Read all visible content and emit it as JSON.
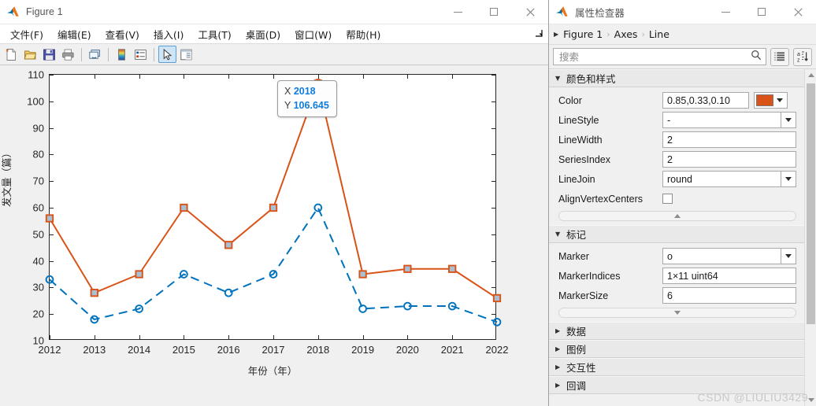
{
  "figure_window": {
    "title": "Figure 1",
    "app_icon": "matlab-logo-icon",
    "window_buttons": {
      "minimize": "—",
      "maximize": "□",
      "close": "✕"
    },
    "menu": [
      {
        "label": "文件(F)",
        "name": "menu-file"
      },
      {
        "label": "编辑(E)",
        "name": "menu-edit"
      },
      {
        "label": "查看(V)",
        "name": "menu-view"
      },
      {
        "label": "插入(I)",
        "name": "menu-insert"
      },
      {
        "label": "工具(T)",
        "name": "menu-tools"
      },
      {
        "label": "桌面(D)",
        "name": "menu-desktop"
      },
      {
        "label": "窗口(W)",
        "name": "menu-window"
      },
      {
        "label": "帮助(H)",
        "name": "menu-help"
      }
    ],
    "toolbar": [
      {
        "name": "new-figure-icon",
        "tooltip": "新建图窗"
      },
      {
        "name": "open-file-icon",
        "tooltip": "打开文件"
      },
      {
        "name": "save-figure-icon",
        "tooltip": "保存图窗"
      },
      {
        "name": "print-figure-icon",
        "tooltip": "打印图窗"
      },
      {
        "name": "link-plot-icon",
        "tooltip": "链接绘图"
      },
      {
        "name": "insert-colorbar-icon",
        "tooltip": "插入颜色栏"
      },
      {
        "name": "insert-legend-icon",
        "tooltip": "插入图例"
      },
      {
        "name": "data-cursor-icon",
        "tooltip": "数据游标",
        "active": true
      },
      {
        "name": "property-inspector-icon",
        "tooltip": "打开属性检查器"
      }
    ]
  },
  "chart_data": {
    "type": "line",
    "title": "",
    "xlabel": "年份（年）",
    "ylabel": "发文量（篇）",
    "xlim": [
      2012,
      2022
    ],
    "ylim": [
      10,
      110
    ],
    "yticks": [
      10,
      20,
      30,
      40,
      50,
      60,
      70,
      80,
      90,
      100,
      110
    ],
    "grid": false,
    "legend_position": "none",
    "categories": [
      2012,
      2013,
      2014,
      2015,
      2016,
      2017,
      2018,
      2019,
      2020,
      2021,
      2022
    ],
    "x_tick_labels": [
      "2012",
      "2013",
      "2014",
      "2015",
      "2016",
      "2017",
      "2018",
      "2019",
      "2020",
      "2021",
      "2022"
    ],
    "series": [
      {
        "name": "series-1-orange",
        "color": "#D95319",
        "linestyle": "-",
        "linewidth": 2,
        "marker": "s",
        "markerfacecolor": "#A9BFD2",
        "values": [
          56,
          28,
          35,
          60,
          46,
          60,
          106.645,
          35,
          37,
          37,
          26
        ]
      },
      {
        "name": "series-2-blue",
        "color": "#0072BD",
        "linestyle": "--",
        "linewidth": 2,
        "marker": "o",
        "markerfacecolor": "none",
        "values": [
          33,
          18,
          22,
          35,
          28,
          35,
          60,
          22,
          23,
          23,
          17
        ]
      }
    ],
    "datatip": {
      "x_label": "X",
      "x_value": "2018",
      "y_label": "Y",
      "y_value": "106.645",
      "attached_series": "series-1-orange"
    }
  },
  "inspector": {
    "title": "属性检查器",
    "app_icon": "matlab-logo-icon",
    "window_buttons": {
      "minimize": "—",
      "maximize": "□",
      "close": "✕"
    },
    "breadcrumb": [
      "Figure 1",
      "Axes",
      "Line"
    ],
    "breadcrumb_separator": "›",
    "search": {
      "placeholder": "搜索",
      "value": ""
    },
    "view_buttons": [
      {
        "name": "group-by-category-button",
        "glyph": "list-group-icon"
      },
      {
        "name": "sort-alphabetically-button",
        "glyph": "a-z-sort-icon"
      }
    ],
    "sections": [
      {
        "name": "section-colors-and-styling",
        "title": "颜色和样式",
        "expanded": true,
        "properties": [
          {
            "name": "color",
            "label": "Color",
            "value": "0.85,0.33,0.10",
            "control": "color",
            "swatch": "#D95319"
          },
          {
            "name": "linestyle",
            "label": "LineStyle",
            "value": "-",
            "control": "dropdown"
          },
          {
            "name": "linewidth",
            "label": "LineWidth",
            "value": "2",
            "control": "text"
          },
          {
            "name": "seriesindex",
            "label": "SeriesIndex",
            "value": "2",
            "control": "text"
          },
          {
            "name": "linejoin",
            "label": "LineJoin",
            "value": "round",
            "control": "dropdown"
          },
          {
            "name": "alignvertexcenters",
            "label": "AlignVertexCenters",
            "value": "",
            "control": "checkbox",
            "checked": false
          }
        ],
        "expander": "collapse-up"
      },
      {
        "name": "section-markers",
        "title": "标记",
        "expanded": true,
        "properties": [
          {
            "name": "marker",
            "label": "Marker",
            "value": "o",
            "control": "dropdown"
          },
          {
            "name": "markerindices",
            "label": "MarkerIndices",
            "value": "1×11 uint64",
            "control": "text"
          },
          {
            "name": "markersize",
            "label": "MarkerSize",
            "value": "6",
            "control": "text"
          }
        ],
        "expander": "expand-down"
      },
      {
        "name": "section-data",
        "title": "数据",
        "expanded": false,
        "properties": []
      },
      {
        "name": "section-legend",
        "title": "图例",
        "expanded": false,
        "properties": []
      },
      {
        "name": "section-interactivity",
        "title": "交互性",
        "expanded": false,
        "properties": []
      },
      {
        "name": "section-callbacks",
        "title": "回调",
        "expanded": false,
        "properties": []
      }
    ],
    "watermark": "CSDN @LIULIU3429"
  }
}
